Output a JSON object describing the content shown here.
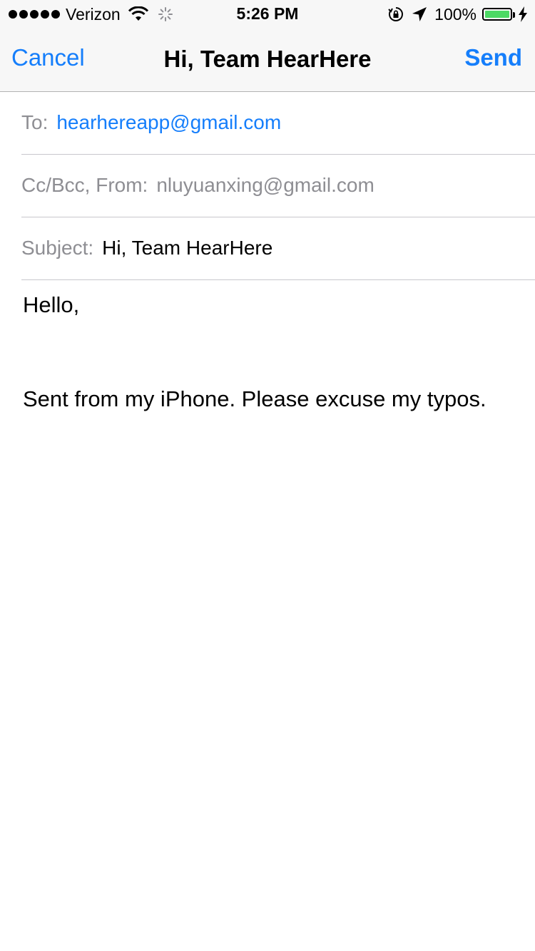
{
  "status_bar": {
    "carrier": "Verizon",
    "time": "5:26 PM",
    "battery_percent": "100%",
    "signal_bars": 5,
    "battery_color": "#4cd964"
  },
  "nav": {
    "cancel_label": "Cancel",
    "title": "Hi, Team HearHere",
    "send_label": "Send",
    "accent_color": "#157efb"
  },
  "fields": {
    "to_label": "To:",
    "to_value": "hearhereapp@gmail.com",
    "ccbcc_label": "Cc/Bcc, From:",
    "from_value": "nluyuanxing@gmail.com",
    "subject_label": "Subject:",
    "subject_value": "Hi, Team HearHere"
  },
  "body": {
    "greeting": "Hello,",
    "signature": "Sent from my iPhone. Please excuse my typos."
  }
}
